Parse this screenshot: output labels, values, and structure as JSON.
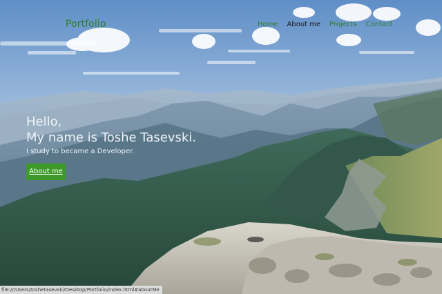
{
  "nav": {
    "brand": "Portfolio",
    "links": [
      {
        "label": "Home"
      },
      {
        "label": "About me"
      },
      {
        "label": "Projects"
      },
      {
        "label": "Contact"
      }
    ],
    "active_index": 1
  },
  "intro": {
    "hello": "Hello,",
    "name_line": "My name is Toshe Tasevski.",
    "tagline": "I study to became a Developer.",
    "button_label": "About me"
  },
  "status_bar": {
    "url": "file:///Users/toshetasevski/Desktop/Portfolio/index.html#aboutMe"
  },
  "colors": {
    "brand": "#2f7d2f",
    "button": "#3d9a2a",
    "sky": "#8fb4d8",
    "text_light": "#eef3f8"
  }
}
